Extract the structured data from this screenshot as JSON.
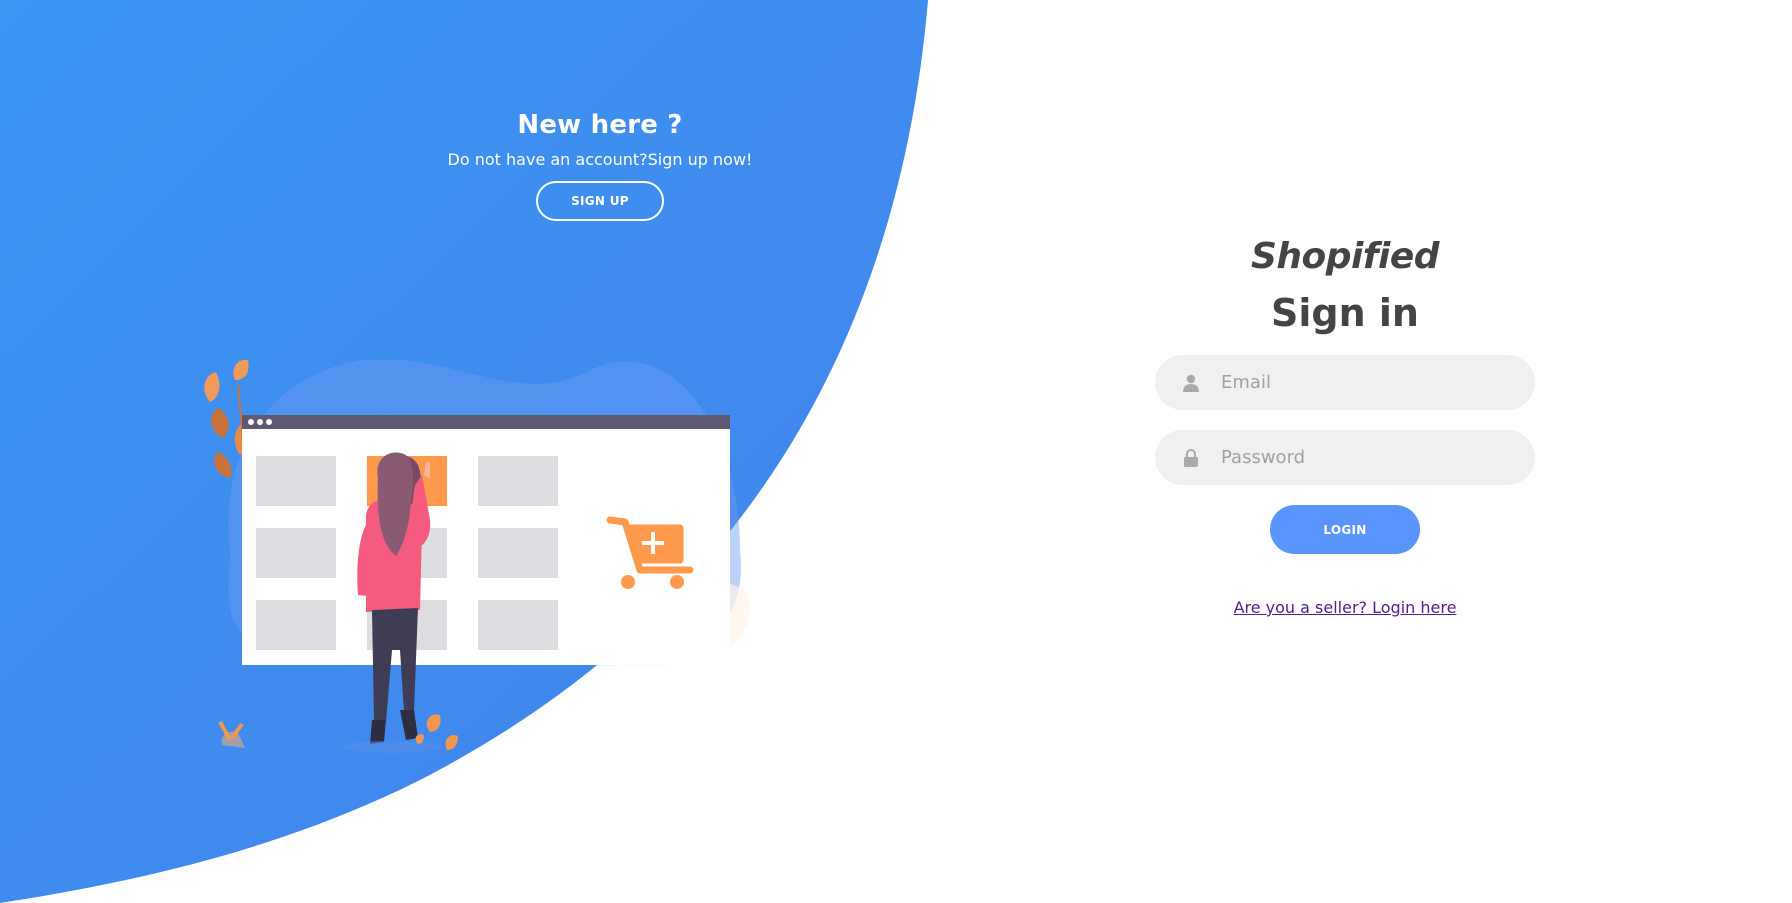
{
  "left_panel": {
    "heading": "New here ?",
    "text": "Do not have an account?Sign up now!",
    "signup_button": "SIGN UP"
  },
  "signin": {
    "brand": "Shopified",
    "title": "Sign in",
    "email_placeholder": "Email",
    "password_placeholder": "Password",
    "login_button": "LOGIN",
    "seller_link": "Are you a seller? Login here"
  },
  "colors": {
    "accent": "#5995fd",
    "panel_blue": "#3d8cee",
    "illustration_orange": "#ff9a4d",
    "illustration_pink": "#f55b7e"
  },
  "icons": {
    "email": "user-icon",
    "password": "lock-icon",
    "cart": "cart-plus-icon"
  }
}
